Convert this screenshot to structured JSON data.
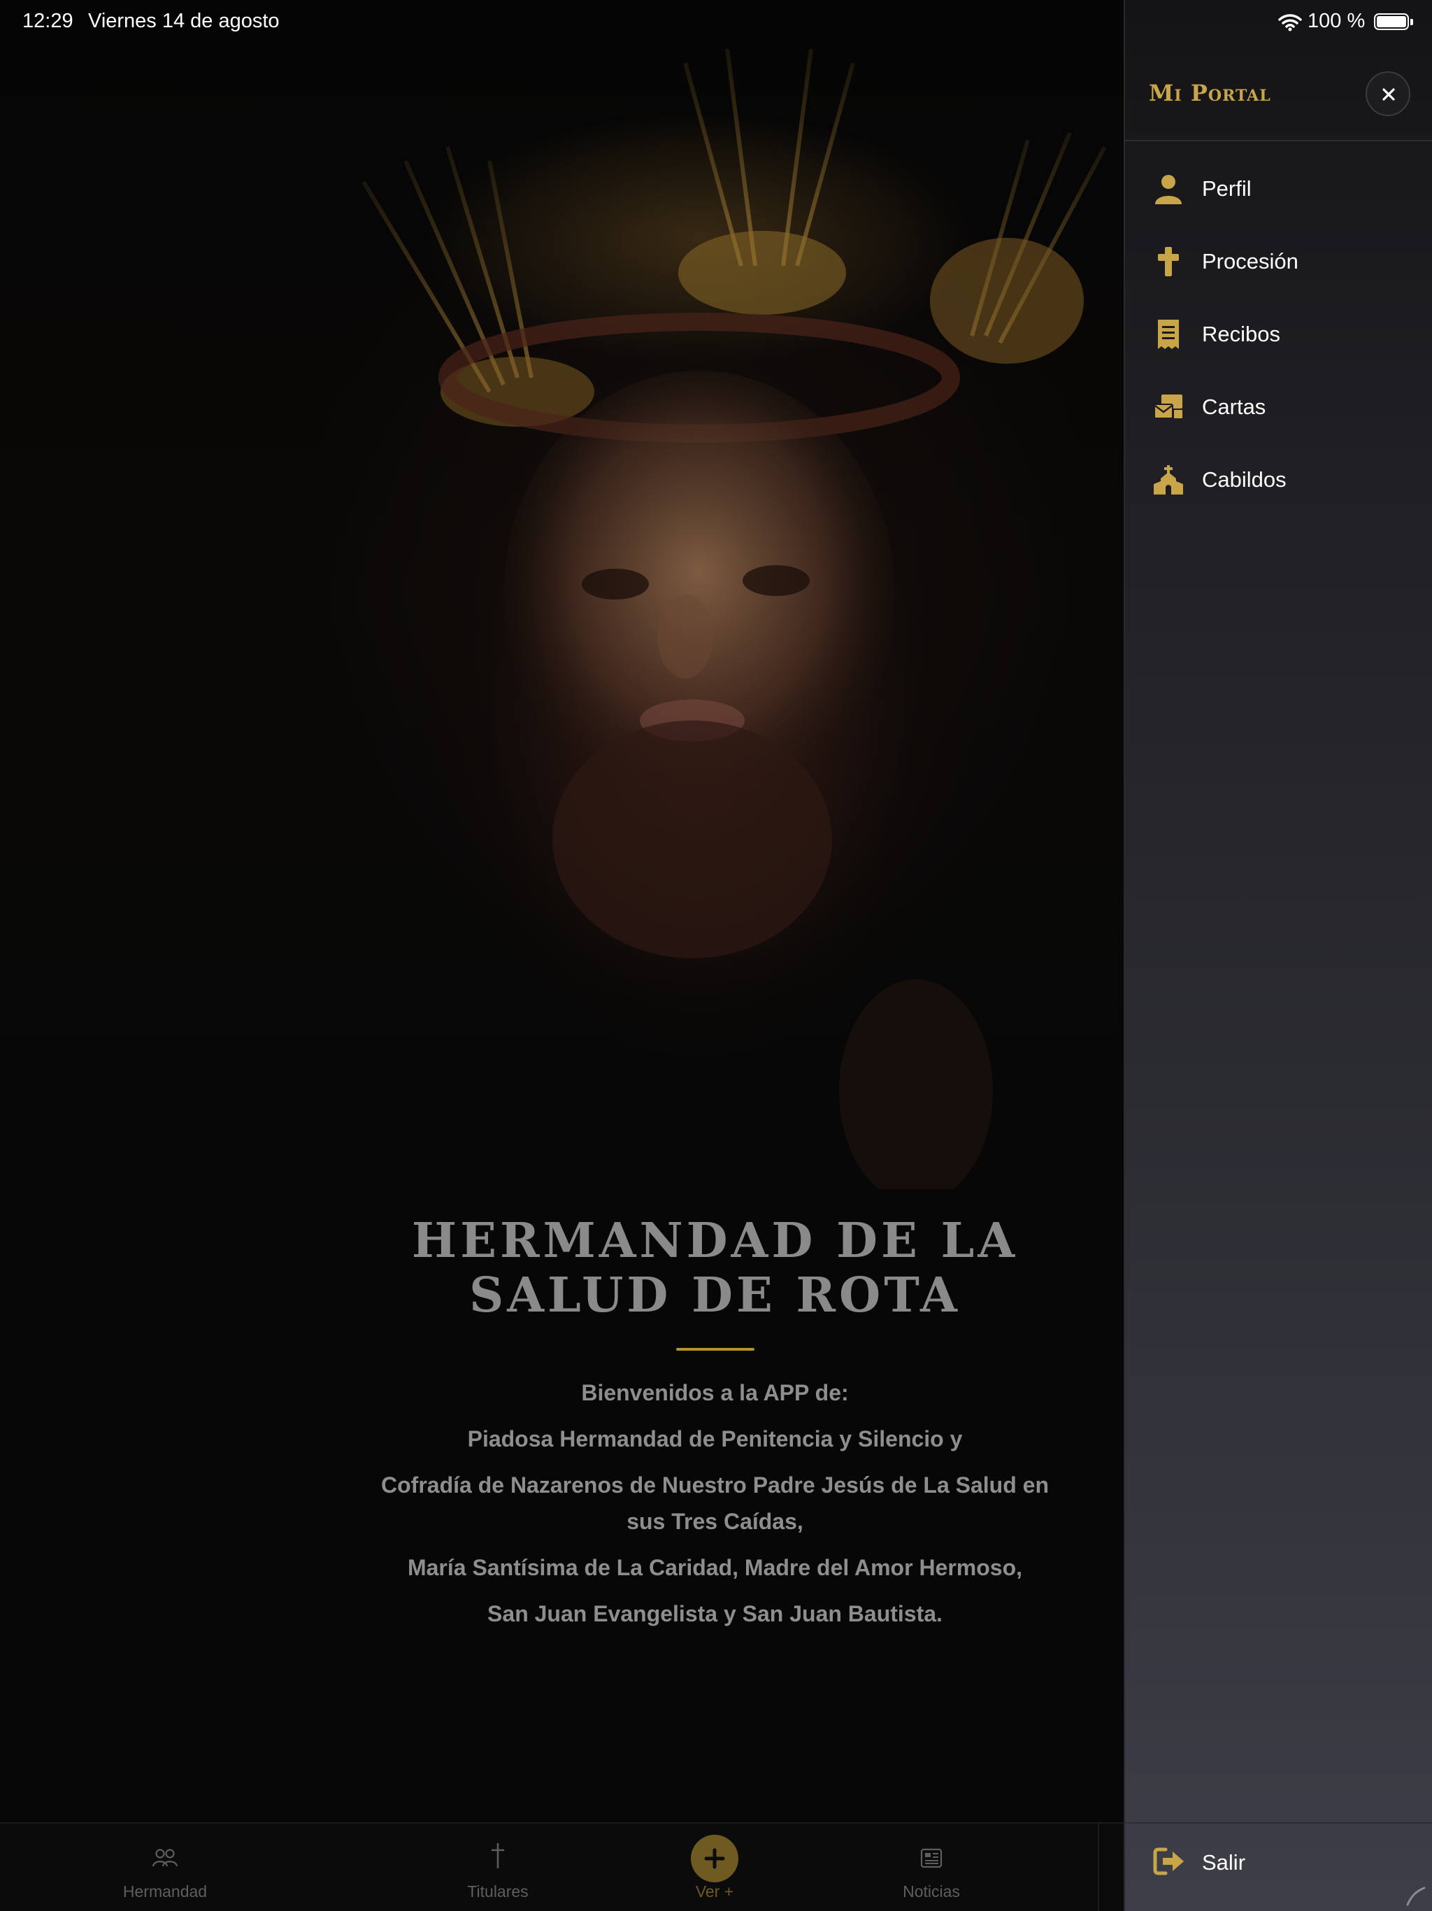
{
  "status_bar": {
    "time": "12:29",
    "date": "Viernes 14 de agosto",
    "battery": "100 %"
  },
  "welcome": {
    "title_line1": "HERMANDAD DE LA",
    "title_line2": "SALUD DE ROTA",
    "intro": "Bienvenidos a la APP de:",
    "line1": "Piadosa Hermandad de Penitencia y Silencio y",
    "line2": "Cofradía de Nazarenos de Nuestro Padre Jesús de La Salud en sus Tres Caídas,",
    "line3": "María Santísima de La Caridad, Madre del Amor Hermoso,",
    "line4": "San Juan Evangelista y San Juan Bautista."
  },
  "tabbar": {
    "tabs": [
      {
        "label": "Hermandad",
        "icon": "people-icon"
      },
      {
        "label": "Titulares",
        "icon": "cross-icon"
      },
      {
        "label": "Ver +",
        "icon": "plus-icon"
      },
      {
        "label": "Noticias",
        "icon": "newspaper-icon"
      }
    ]
  },
  "drawer": {
    "title": "Mi Portal",
    "items": [
      {
        "label": "Perfil",
        "icon": "user-icon"
      },
      {
        "label": "Procesión",
        "icon": "cross-icon"
      },
      {
        "label": "Recibos",
        "icon": "receipt-icon"
      },
      {
        "label": "Cartas",
        "icon": "mail-bulk-icon"
      },
      {
        "label": "Cabildos",
        "icon": "church-icon"
      }
    ],
    "logout_label": "Salir"
  },
  "colors": {
    "accent_gold": "#c9a54a",
    "background": "#070707",
    "drawer_bottom": "#3e3e48"
  }
}
